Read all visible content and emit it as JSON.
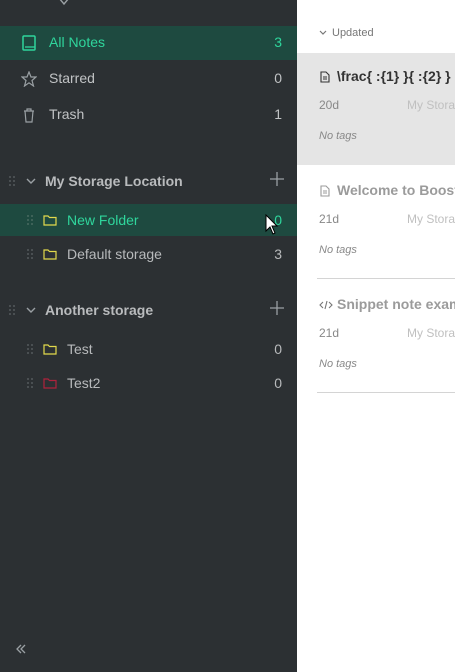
{
  "sidebar": {
    "nav": [
      {
        "label": "All Notes",
        "count": "3",
        "icon": "book-icon"
      },
      {
        "label": "Starred",
        "count": "0",
        "icon": "star-icon"
      },
      {
        "label": "Trash",
        "count": "1",
        "icon": "trash-icon"
      }
    ],
    "storages": [
      {
        "name": "My Storage Location",
        "folders": [
          {
            "label": "New Folder",
            "count": "0",
            "color": "#e2d94c"
          },
          {
            "label": "Default storage",
            "count": "3",
            "color": "#e2d94c"
          }
        ]
      },
      {
        "name": "Another storage",
        "folders": [
          {
            "label": "Test",
            "count": "0",
            "color": "#e2d94c"
          },
          {
            "label": "Test2",
            "count": "0",
            "color": "#b0223c"
          }
        ]
      }
    ]
  },
  "notelist": {
    "sort_label": "Updated",
    "notes": [
      {
        "title": "\\frac{ :{1} }{ :{2} }",
        "date": "20d",
        "storage": "My Storage Location",
        "tags": "No tags",
        "type": "document-icon"
      },
      {
        "title": "Welcome to Boostnote!",
        "date": "21d",
        "storage": "My Storage Location",
        "tags": "No tags",
        "type": "document-icon"
      },
      {
        "title": "Snippet note example",
        "date": "21d",
        "storage": "My Storage Location",
        "tags": "No tags",
        "type": "code-icon"
      }
    ]
  },
  "colors": {
    "accent": "#2fd69c",
    "sidebar_bg": "#2c3033",
    "active_bg": "#1e4a40",
    "folder_yellow": "#e2d94c",
    "folder_red": "#b0223c"
  }
}
